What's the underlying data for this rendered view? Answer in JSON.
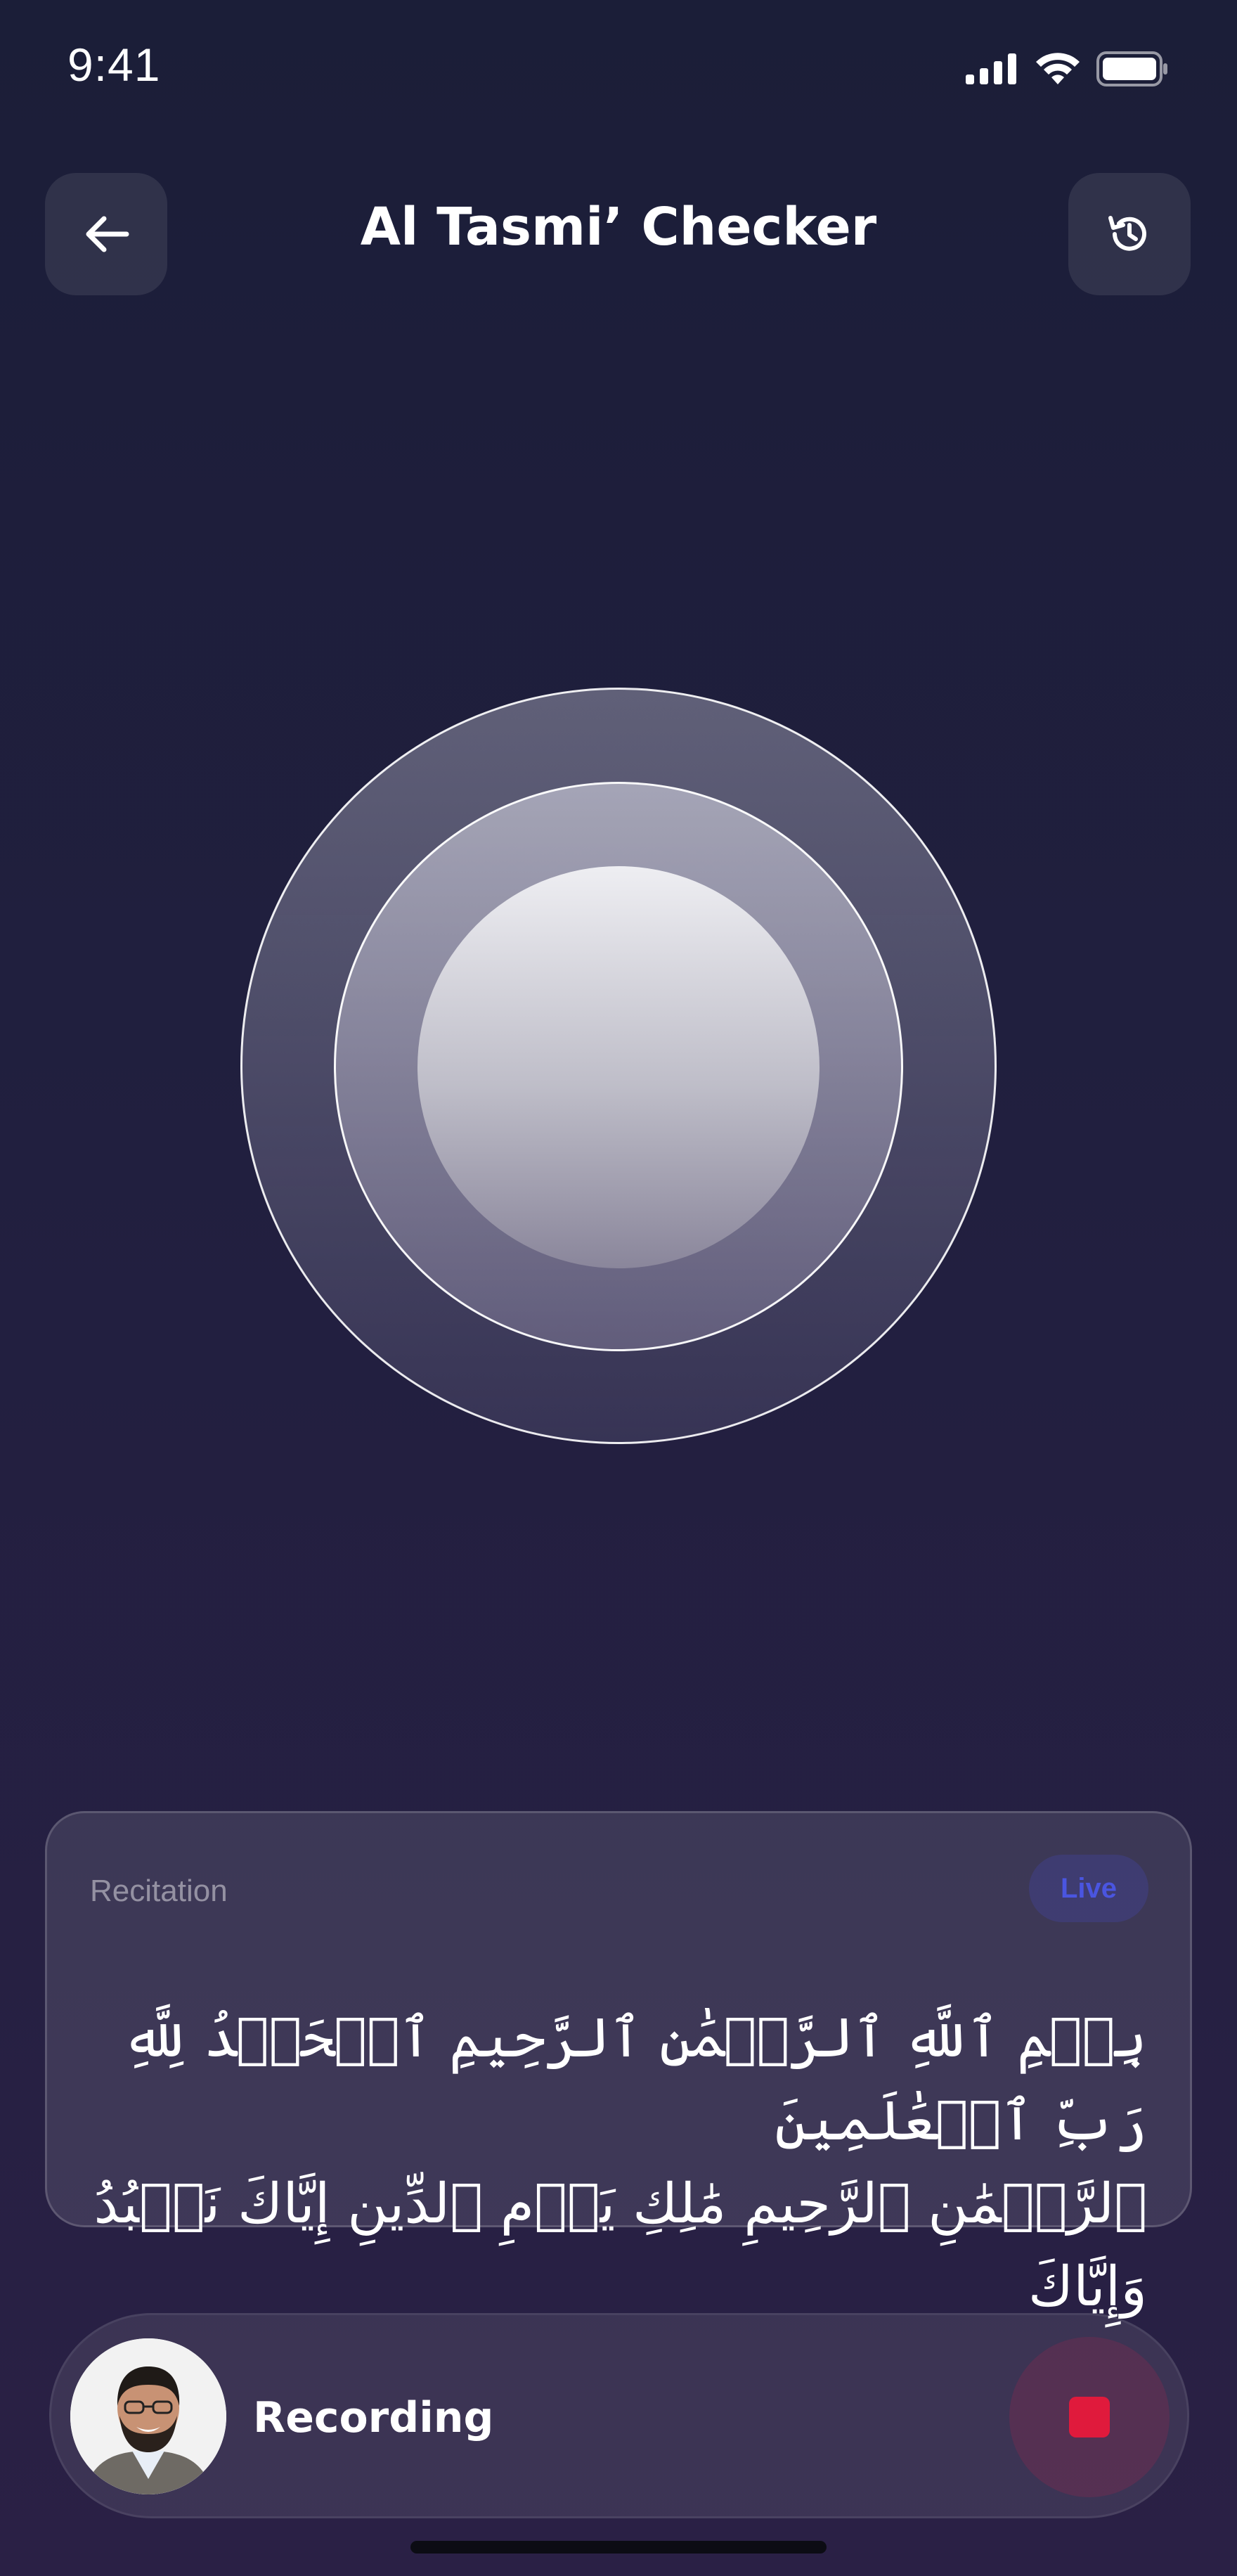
{
  "status_bar": {
    "time": "9:41"
  },
  "header": {
    "title": "Al Tasmi’ Checker",
    "back_icon": "arrow-left-icon",
    "history_icon": "history-icon"
  },
  "orb": {
    "icon": "voice-orb"
  },
  "recitation_card": {
    "label": "Recitation",
    "badge": "Live",
    "lines": [
      "بِسۡمِ ٱللَّهِ ٱلرَّحۡمَٰنِ ٱلرَّحِيمِ ٱلۡحَمۡدُ لِلَّهِ رَبِّ ٱلۡعَٰلَمِينَ",
      "ٱلرَّحۡمَٰنِ ٱلرَّحِيمِ مَٰلِكِ يَوۡمِ ٱلدِّينِ إِيَّاكَ نَعۡبُدُ وَإِيَّاكَ"
    ]
  },
  "recording_bar": {
    "label": "Recording",
    "avatar_icon": "user-avatar",
    "waveform_icon": "audio-waveform",
    "stop_icon": "stop-icon"
  },
  "colors": {
    "accent": "#4a55e0",
    "stop": "#e01a3c",
    "background_top": "#1b1e38",
    "background_bottom": "#2a2045"
  }
}
